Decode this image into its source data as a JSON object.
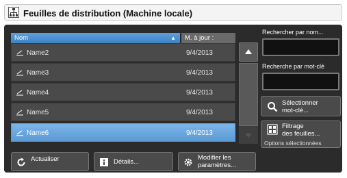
{
  "window": {
    "title": "Feuilles de distribution (Machine locale)",
    "icon": "distribution-sheet-icon"
  },
  "table": {
    "columns": [
      {
        "label": "Nom",
        "sort": "ascending"
      },
      {
        "label": "M. à jour :"
      }
    ],
    "rows": [
      {
        "name": "Name2",
        "date": "9/4/2013",
        "icon": "sheet-icon",
        "selected": false
      },
      {
        "name": "Name3",
        "date": "9/4/2013",
        "icon": "sheet-icon",
        "selected": false
      },
      {
        "name": "Name4",
        "date": "9/4/2013",
        "icon": "sheet-icon",
        "selected": false
      },
      {
        "name": "Name5",
        "date": "9/4/2013",
        "icon": "sheet-icon",
        "selected": false
      },
      {
        "name": "Name6",
        "date": "9/4/2013",
        "icon": "sheet-icon",
        "selected": true
      }
    ]
  },
  "search": {
    "by_name_label": "Rechercher par nom...",
    "by_name_value": "",
    "by_keyword_label": "Recherche par mot-clé",
    "by_keyword_value": ""
  },
  "buttons": {
    "select_keyword": "Sélectionner\nmot-clé...",
    "filter_sheets": "Filtrage\ndes feuilles...",
    "filter_sheets_sub": "Options sélectionnées",
    "refresh": "Actualiser",
    "details": "Détails...",
    "modify_params": "Modifier les\nparamètres..."
  },
  "colors": {
    "panel": "#2b2b2b",
    "accent": "#4a90d9",
    "row": "#4a4a4a",
    "selected_row": "#6aa8e2"
  }
}
